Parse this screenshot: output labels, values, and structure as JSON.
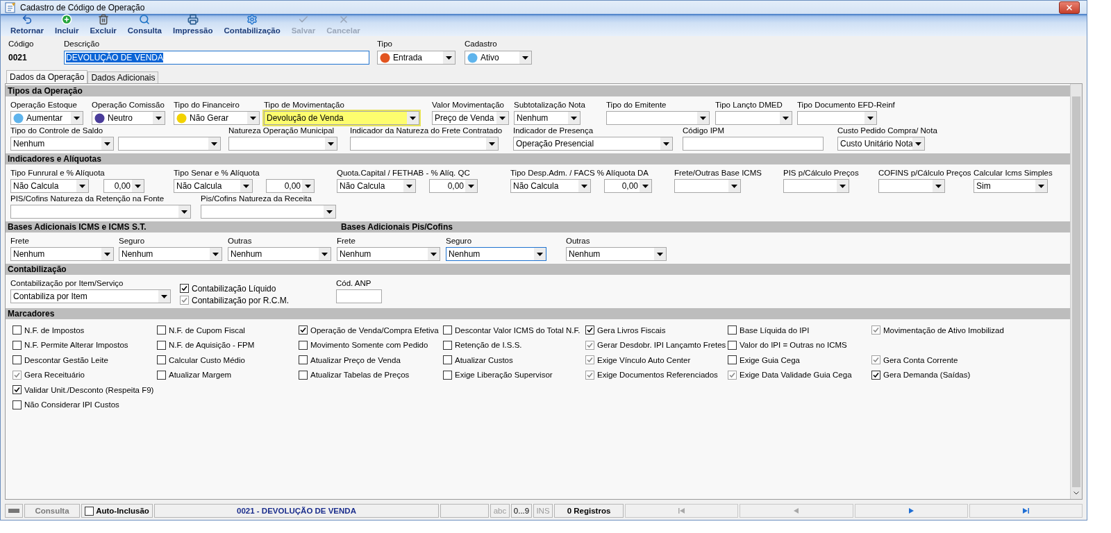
{
  "window": {
    "title": "Cadastro de Código de Operação"
  },
  "toolbar": [
    {
      "kind": "back",
      "label": "Retornar",
      "disabled": false
    },
    {
      "kind": "add",
      "label": "Incluir",
      "disabled": false
    },
    {
      "kind": "delete",
      "label": "Excluir",
      "disabled": false
    },
    {
      "kind": "search",
      "label": "Consulta",
      "disabled": false
    },
    {
      "kind": "print",
      "label": "Impressão",
      "disabled": false
    },
    {
      "kind": "gear",
      "label": "Contabilização",
      "disabled": false
    },
    {
      "kind": "save",
      "label": "Salvar",
      "disabled": true
    },
    {
      "kind": "cancel",
      "label": "Cancelar",
      "disabled": true
    }
  ],
  "header": {
    "codigo": {
      "label": "Código",
      "value": "0021"
    },
    "descricao": {
      "label": "Descrição",
      "value": "DEVOLUÇÃO DE VENDA"
    },
    "tipo": {
      "label": "Tipo",
      "value": "Entrada",
      "color": "#e2541f"
    },
    "cadastro": {
      "label": "Cadastro",
      "value": "Ativo",
      "color": "#5fb4ec"
    }
  },
  "tabs": [
    {
      "label": "Dados da Operação",
      "selected": true
    },
    {
      "label": "Dados Adicionais",
      "selected": false
    }
  ],
  "sections": [
    {
      "title": "Tipos da Operação",
      "rows": [
        {
          "fields": [
            {
              "kind": "dot-combo",
              "label": "Operação Estoque",
              "value": "Aumentar",
              "color": "#5fb4ec",
              "highlighted": false
            },
            {
              "kind": "dot-combo",
              "label": "Operação Comissão",
              "value": "Neutro",
              "color": "#4a3c9a",
              "highlighted": false
            },
            {
              "kind": "dot-combo",
              "label": "Tipo do Financeiro",
              "value": "Não Gerar",
              "color": "#f2d200",
              "highlighted": false
            },
            {
              "kind": "combo",
              "label": "Tipo de Movimentação",
              "value": "Devolução de Venda",
              "highlighted": true
            },
            {
              "kind": "combo",
              "label": "Valor Movimentação",
              "value": "Preço de Venda",
              "highlighted": false
            },
            {
              "kind": "combo",
              "label": "Subtotalização Nota",
              "value": "Nenhum",
              "highlighted": false
            },
            {
              "kind": "combo",
              "label": "Tipo do Emitente",
              "highlighted": false
            },
            {
              "kind": "combo",
              "label": "Tipo Lançto DMED",
              "highlighted": false
            },
            {
              "kind": "combo",
              "label": "Tipo Documento EFD-Reinf",
              "highlighted": false
            }
          ]
        },
        {
          "fields": [
            {
              "kind": "combo",
              "label": "Tipo do Controle de Saldo",
              "value": "Nenhum"
            },
            {
              "kind": "combo"
            },
            {
              "kind": "combo",
              "label": "Natureza Operação Municipal"
            },
            {
              "kind": "combo",
              "label": "Indicador da Natureza do Frete Contratado"
            },
            {
              "kind": "combo",
              "label": "Indicador de Presença",
              "value": "Operação Presencial"
            },
            {
              "kind": "text",
              "label": "Código IPM"
            },
            {
              "kind": "combo",
              "label": "Custo Pedido Compra/ Nota",
              "value": "Custo Unitário Nota"
            }
          ]
        }
      ]
    },
    {
      "title": "Indicadores e Alíquotas",
      "rows": [
        {
          "fields": [
            {
              "kind": "combo",
              "label": "Tipo Funrural e % Alíquota",
              "value": "Não Calcula"
            },
            {
              "kind": "number",
              "value": "0,00"
            },
            {
              "kind": "combo",
              "label": "Tipo Senar e % Alíquota",
              "value": "Não Calcula"
            },
            {
              "kind": "number",
              "value": "0,00"
            },
            {
              "kind": "combo",
              "label": "Quota.Capital / FETHAB - % Alíq. QC",
              "value": "Não Calcula"
            },
            {
              "kind": "number",
              "value": "0,00"
            },
            {
              "kind": "combo",
              "label": "Tipo Desp.Adm. / FACS % Alíquota DA",
              "value": "Não Calcula"
            },
            {
              "kind": "number",
              "value": "0,00"
            },
            {
              "kind": "combo",
              "label": "Frete/Outras Base ICMS"
            },
            {
              "kind": "combo",
              "label": "PIS p/Cálculo Preços"
            },
            {
              "kind": "combo",
              "label": "COFINS p/Cálculo Preços"
            },
            {
              "kind": "combo",
              "label": "Calcular Icms Simples",
              "value": "Sim"
            }
          ]
        },
        {
          "fields": [
            {
              "kind": "combo",
              "label": "PIS/Cofins Natureza da Retenção na Fonte"
            },
            {
              "kind": "combo",
              "label": "Pis/Cofins Natureza da Receita"
            }
          ]
        }
      ]
    },
    {
      "title": "Bases Adicionais ICMS e ICMS S.T.",
      "title_2": "Bases Adicionais Pis/Cofins",
      "rows": [
        {
          "fields": [
            {
              "kind": "combo",
              "label": "Frete",
              "value": "Nenhum",
              "focused": false
            },
            {
              "kind": "combo",
              "label": "Seguro",
              "value": "Nenhum",
              "focused": false
            },
            {
              "kind": "combo",
              "label": "Outras",
              "value": "Nenhum",
              "focused": false
            },
            {
              "kind": "combo",
              "label": "Frete",
              "value": "Nenhum",
              "focused": false
            },
            {
              "kind": "combo",
              "label": "Seguro",
              "value": "Nenhum",
              "focused": true
            },
            {
              "kind": "combo",
              "label": "Outras",
              "value": "Nenhum",
              "focused": false
            }
          ]
        }
      ]
    },
    {
      "title": "Contabilização",
      "rows": [
        {
          "fields": [
            {
              "kind": "combo",
              "label": "Contabilização por Item/Serviço",
              "value": "Contabiliza por Item"
            },
            {
              "kind": "checks",
              "items": [
                {
                  "label": "Contabilização Líquido",
                  "checked": true,
                  "disabled": false
                },
                {
                  "label": "Contabilização por R.C.M.",
                  "checked": true,
                  "disabled": true
                }
              ]
            },
            {
              "kind": "text",
              "label": "Cód. ANP"
            }
          ]
        }
      ]
    }
  ],
  "marcadores": {
    "title": "Marcadores",
    "rows": [
      [
        {
          "label": "N.F. de Impostos",
          "checked": false,
          "disabled": false
        },
        {
          "label": "N.F. de Cupom Fiscal",
          "checked": false,
          "disabled": false
        },
        {
          "label": "Operação de Venda/Compra Efetiva",
          "checked": true,
          "disabled": false
        },
        {
          "label": "Descontar Valor ICMS do Total N.F.",
          "checked": false,
          "disabled": false
        },
        {
          "label": "Gera Livros Fiscais",
          "checked": true,
          "disabled": false
        },
        {
          "label": "Base Líquida do IPI",
          "checked": false,
          "disabled": false
        },
        {
          "label": "Movimentação de Ativo Imobilizad",
          "checked": true,
          "disabled": true
        }
      ],
      [
        {
          "label": "N.F. Permite Alterar Impostos",
          "checked": false,
          "disabled": false
        },
        {
          "label": "N.F. de Aquisição - FPM",
          "checked": false,
          "disabled": false
        },
        {
          "label": "Movimento Somente com Pedido",
          "checked": false,
          "disabled": false
        },
        {
          "label": "Retenção de I.S.S.",
          "checked": false,
          "disabled": false
        },
        {
          "label": "Gerar Desdobr. IPI Lançamto Fretes",
          "checked": true,
          "disabled": true
        },
        {
          "label": "Valor do IPI = Outras no ICMS",
          "checked": false,
          "disabled": false
        }
      ],
      [
        {
          "label": "Descontar Gestão Leite",
          "checked": false,
          "disabled": false
        },
        {
          "label": "Calcular Custo Médio",
          "checked": false,
          "disabled": false
        },
        {
          "label": "Atualizar Preço de Venda",
          "checked": false,
          "disabled": false
        },
        {
          "label": "Atualizar Custos",
          "checked": false,
          "disabled": false
        },
        {
          "label": "Exige Vínculo Auto Center",
          "checked": true,
          "disabled": true
        },
        {
          "label": "Exige Guia Cega",
          "checked": false,
          "disabled": false
        },
        {
          "label": "Gera Conta Corrente",
          "checked": true,
          "disabled": true
        }
      ],
      [
        {
          "label": "Gera Receituário",
          "checked": true,
          "disabled": true
        },
        {
          "label": "Atualizar Margem",
          "checked": false,
          "disabled": false
        },
        {
          "label": "Atualizar Tabelas de Preços",
          "checked": false,
          "disabled": false
        },
        {
          "label": "Exige Liberação Supervisor",
          "checked": false,
          "disabled": false
        },
        {
          "label": "Exige Documentos Referenciados",
          "checked": true,
          "disabled": true
        },
        {
          "label": "Exige Data Validade Guia Cega",
          "checked": true,
          "disabled": true
        },
        {
          "label": "Gera Demanda (Saídas)",
          "checked": true,
          "disabled": false
        }
      ],
      [
        {
          "label": "Validar Unit./Desconto (Respeita F9)",
          "checked": true,
          "disabled": false
        }
      ],
      [
        {
          "label": "Não Considerar IPI Custos",
          "checked": false,
          "disabled": false
        }
      ]
    ]
  },
  "status_bar": {
    "mode": "Consulta",
    "auto_inclusao": {
      "label": "Auto-Inclusão",
      "checked": false
    },
    "record": "0021 - DEVOLUÇÃO DE VENDA",
    "indicators": [
      {
        "label": "abc",
        "active": false
      },
      {
        "label": "0...9",
        "active": true
      },
      {
        "label": "INS",
        "active": false
      }
    ],
    "count": "0 Registros",
    "nav": [
      {
        "kind": "first",
        "disabled": true
      },
      {
        "kind": "prev",
        "disabled": true
      },
      {
        "kind": "next",
        "disabled": false
      },
      {
        "kind": "last",
        "disabled": false
      }
    ]
  }
}
